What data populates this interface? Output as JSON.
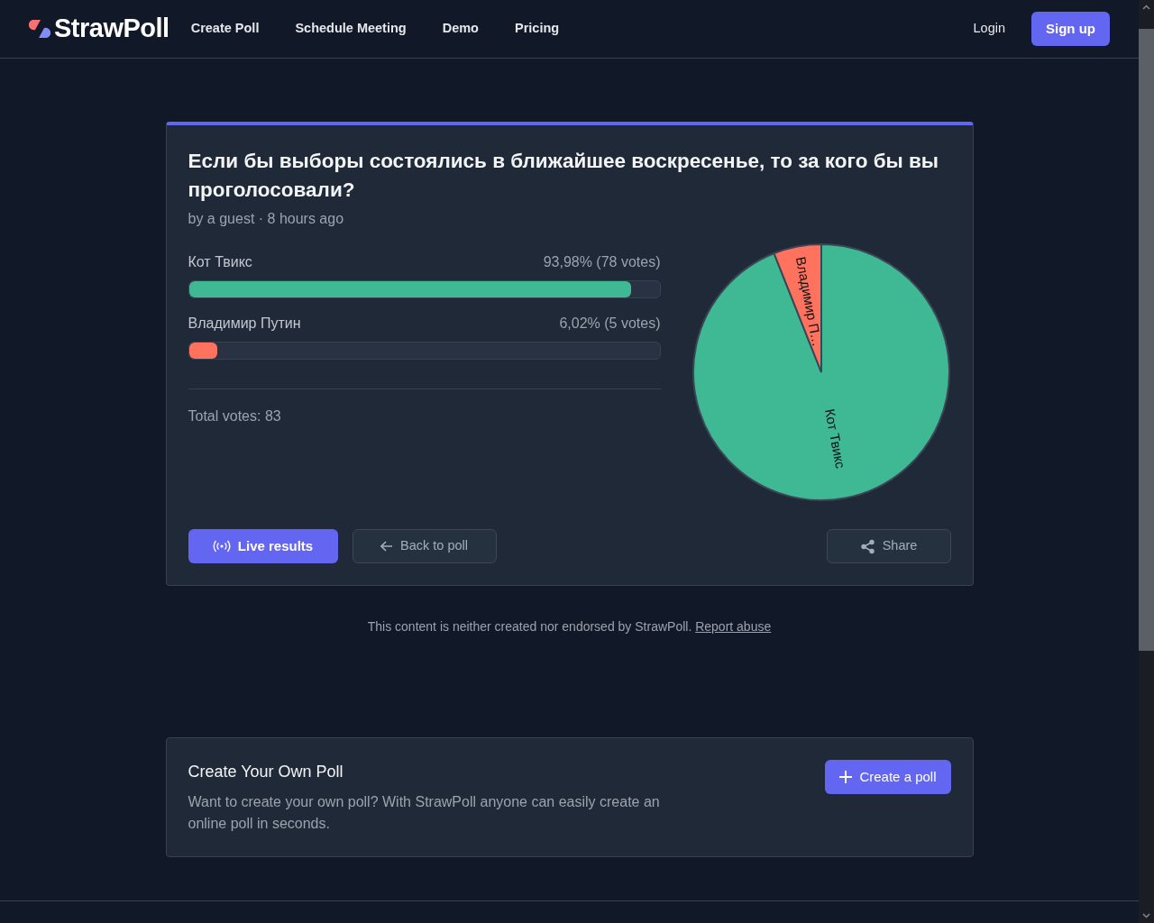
{
  "navbar": {
    "brand": "StrawPoll",
    "links": [
      "Create Poll",
      "Schedule Meeting",
      "Demo",
      "Pricing"
    ],
    "login": "Login",
    "signup": "Sign up"
  },
  "poll": {
    "title": "Если бы выборы состоялись в ближайшее воскресенье, то за кого бы вы проголосовали?",
    "meta": "by a guest · 8 hours ago",
    "options": [
      {
        "name": "Кот Твикс",
        "result": "93,98% (78 votes)",
        "level": 0.9398,
        "color": "#3fb993"
      },
      {
        "name": "Владимир Путин",
        "result": "6,02% (5 votes)",
        "level": 0.0602,
        "color": "#ff725e"
      }
    ],
    "total": "Total votes: 83",
    "chart_data": {
      "type": "pie",
      "categories": [
        "Кот Твикс",
        "Владимир П…"
      ],
      "values": [
        93.98,
        6.02
      ]
    },
    "buttons": [
      {
        "kind": "live",
        "label": "Live results"
      },
      {
        "kind": "back",
        "label": "Back to poll"
      },
      {
        "kind": "share",
        "label": "Share"
      }
    ]
  },
  "disclaimer": {
    "text": "This content is neither created nor endorsed by StrawPoll.",
    "link": "Report abuse"
  },
  "cta": {
    "title": "Create Your Own Poll",
    "text": "Want to create your own poll? With StrawPoll anyone can easily create an online poll in seconds.",
    "button": "Create a poll"
  }
}
